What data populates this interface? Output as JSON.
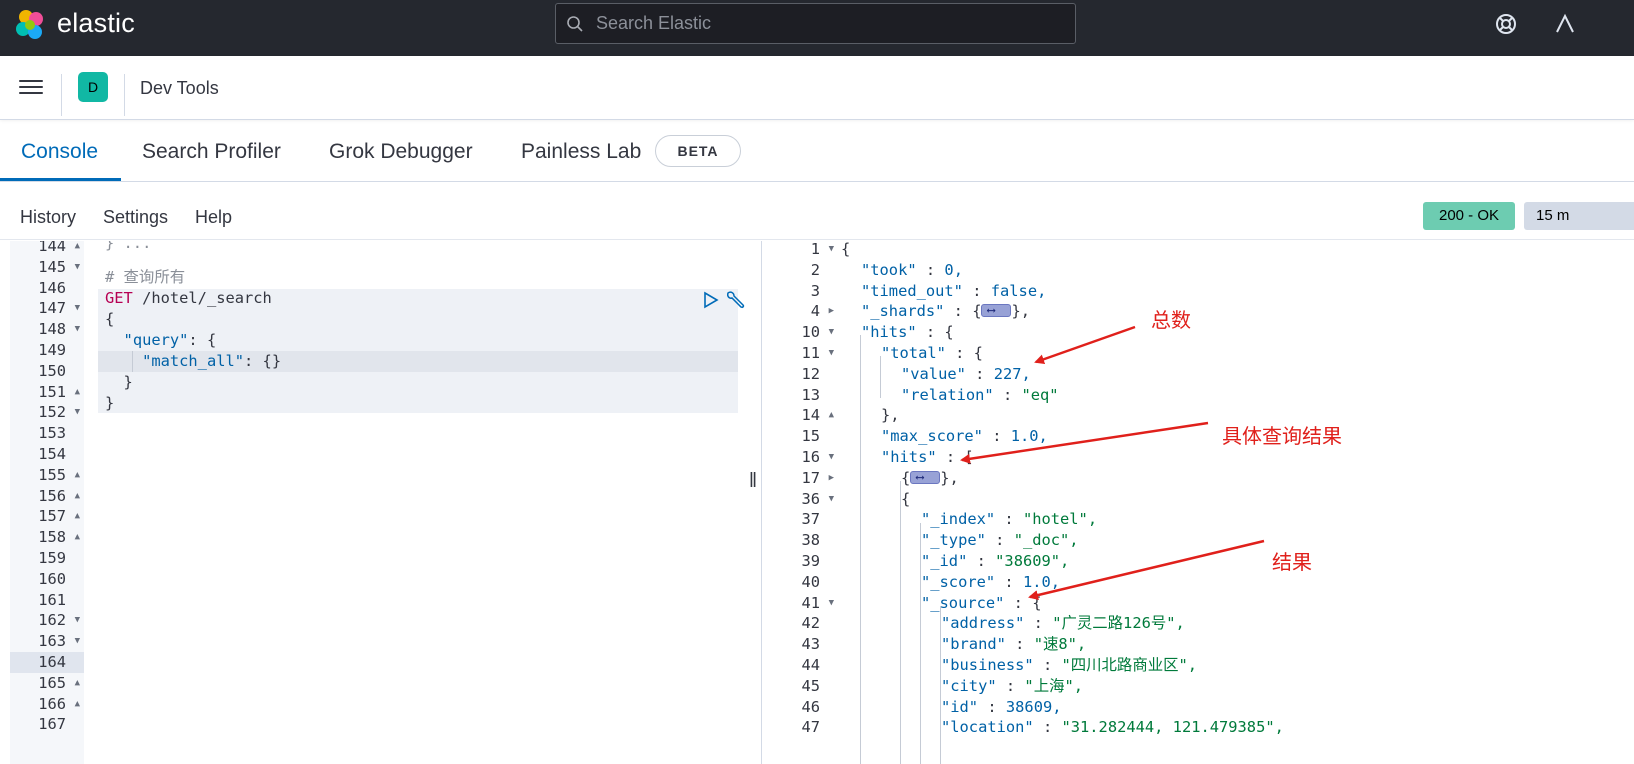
{
  "header": {
    "brand": "elastic",
    "search_placeholder": "Search Elastic"
  },
  "breadcrumb": {
    "space_initial": "D",
    "title": "Dev Tools"
  },
  "tabs": [
    {
      "label": "Console",
      "active": true
    },
    {
      "label": "Search Profiler",
      "active": false
    },
    {
      "label": "Grok Debugger",
      "active": false
    },
    {
      "label": "Painless Lab",
      "active": false
    }
  ],
  "beta_badge": "BETA",
  "toolbar": {
    "history": "History",
    "settings": "Settings",
    "help": "Help",
    "status": "200 - OK",
    "time": "15 m"
  },
  "request": {
    "gutter": [
      {
        "n": "144",
        "f": "▲"
      },
      {
        "n": "145",
        "f": "▼"
      },
      {
        "n": "146",
        "f": ""
      },
      {
        "n": "147",
        "f": "▼"
      },
      {
        "n": "148",
        "f": "▼"
      },
      {
        "n": "149",
        "f": ""
      },
      {
        "n": "150",
        "f": ""
      },
      {
        "n": "151",
        "f": "▲"
      },
      {
        "n": "152",
        "f": "▼"
      },
      {
        "n": "153",
        "f": ""
      },
      {
        "n": "154",
        "f": ""
      },
      {
        "n": "155",
        "f": "▲"
      },
      {
        "n": "156",
        "f": "▲"
      },
      {
        "n": "157",
        "f": "▲"
      },
      {
        "n": "158",
        "f": "▲"
      },
      {
        "n": "159",
        "f": ""
      },
      {
        "n": "160",
        "f": ""
      },
      {
        "n": "161",
        "f": ""
      },
      {
        "n": "162",
        "f": "▼"
      },
      {
        "n": "163",
        "f": "▼"
      },
      {
        "n": "164",
        "f": ""
      },
      {
        "n": "165",
        "f": "▲"
      },
      {
        "n": "166",
        "f": "▲"
      },
      {
        "n": "167",
        "f": ""
      }
    ],
    "comment": "# 查询所有",
    "method": "GET",
    "path": " /hotel/_search",
    "open_brace": "{",
    "query_key": "\"query\"",
    "query_rest": ": {",
    "match_key": "\"match_all\"",
    "match_rest": ": {}",
    "close_inner": "}",
    "close_outer": "}"
  },
  "response": {
    "gutter": [
      {
        "n": "1",
        "f": "▼"
      },
      {
        "n": "2",
        "f": ""
      },
      {
        "n": "3",
        "f": ""
      },
      {
        "n": "4",
        "f": "▶"
      },
      {
        "n": "10",
        "f": "▼"
      },
      {
        "n": "11",
        "f": "▼"
      },
      {
        "n": "12",
        "f": ""
      },
      {
        "n": "13",
        "f": ""
      },
      {
        "n": "14",
        "f": "▲"
      },
      {
        "n": "15",
        "f": ""
      },
      {
        "n": "16",
        "f": "▼"
      },
      {
        "n": "17",
        "f": "▶"
      },
      {
        "n": "36",
        "f": "▼"
      },
      {
        "n": "37",
        "f": ""
      },
      {
        "n": "38",
        "f": ""
      },
      {
        "n": "39",
        "f": ""
      },
      {
        "n": "40",
        "f": ""
      },
      {
        "n": "41",
        "f": "▼"
      },
      {
        "n": "42",
        "f": ""
      },
      {
        "n": "43",
        "f": ""
      },
      {
        "n": "44",
        "f": ""
      },
      {
        "n": "45",
        "f": ""
      },
      {
        "n": "46",
        "f": ""
      },
      {
        "n": "47",
        "f": ""
      }
    ],
    "lines": [
      {
        "indent": 0,
        "k": "",
        "sep": "",
        "v": "{",
        "vt": "p"
      },
      {
        "indent": 1,
        "k": "\"took\"",
        "sep": " : ",
        "v": "0,",
        "vt": "n"
      },
      {
        "indent": 1,
        "k": "\"timed_out\"",
        "sep": " : ",
        "v": "false,",
        "vt": "n"
      },
      {
        "indent": 1,
        "k": "\"_shards\"",
        "sep": " : {",
        "v": "},",
        "vt": "fold"
      },
      {
        "indent": 1,
        "k": "\"hits\"",
        "sep": " : {",
        "v": "",
        "vt": "p"
      },
      {
        "indent": 2,
        "k": "\"total\"",
        "sep": " : {",
        "v": "",
        "vt": "p"
      },
      {
        "indent": 3,
        "k": "\"value\"",
        "sep": " : ",
        "v": "227,",
        "vt": "n"
      },
      {
        "indent": 3,
        "k": "\"relation\"",
        "sep": " : ",
        "v": "\"eq\"",
        "vt": "s"
      },
      {
        "indent": 2,
        "k": "",
        "sep": "",
        "v": "},",
        "vt": "p"
      },
      {
        "indent": 2,
        "k": "\"max_score\"",
        "sep": " : ",
        "v": "1.0,",
        "vt": "n"
      },
      {
        "indent": 2,
        "k": "\"hits\"",
        "sep": " : ",
        "v": "[",
        "vt": "p"
      },
      {
        "indent": 3,
        "k": "",
        "sep": "{",
        "v": "},",
        "vt": "fold"
      },
      {
        "indent": 3,
        "k": "",
        "sep": "",
        "v": "{",
        "vt": "p"
      },
      {
        "indent": 4,
        "k": "\"_index\"",
        "sep": " : ",
        "v": "\"hotel\",",
        "vt": "s"
      },
      {
        "indent": 4,
        "k": "\"_type\"",
        "sep": " : ",
        "v": "\"_doc\",",
        "vt": "s"
      },
      {
        "indent": 4,
        "k": "\"_id\"",
        "sep": " : ",
        "v": "\"38609\",",
        "vt": "s"
      },
      {
        "indent": 4,
        "k": "\"_score\"",
        "sep": " : ",
        "v": "1.0,",
        "vt": "n"
      },
      {
        "indent": 4,
        "k": "\"_source\"",
        "sep": " : ",
        "v": "{",
        "vt": "p"
      },
      {
        "indent": 5,
        "k": "\"address\"",
        "sep": " : ",
        "v": "\"广灵二路126号\",",
        "vt": "s"
      },
      {
        "indent": 5,
        "k": "\"brand\"",
        "sep": " : ",
        "v": "\"速8\",",
        "vt": "s"
      },
      {
        "indent": 5,
        "k": "\"business\"",
        "sep": " : ",
        "v": "\"四川北路商业区\",",
        "vt": "s"
      },
      {
        "indent": 5,
        "k": "\"city\"",
        "sep": " : ",
        "v": "\"上海\",",
        "vt": "s"
      },
      {
        "indent": 5,
        "k": "\"id\"",
        "sep": " : ",
        "v": "38609,",
        "vt": "n"
      },
      {
        "indent": 5,
        "k": "\"location\"",
        "sep": " : ",
        "v": "\"31.282444, 121.479385\",",
        "vt": "s"
      }
    ]
  },
  "annotations": {
    "total": "总数",
    "hits": "具体查询结果",
    "result": "结果"
  },
  "colors": {
    "header_bg": "#25282f",
    "accent": "#006bb8",
    "status_ok": "#6dccb1",
    "annotation": "#e0201b"
  }
}
